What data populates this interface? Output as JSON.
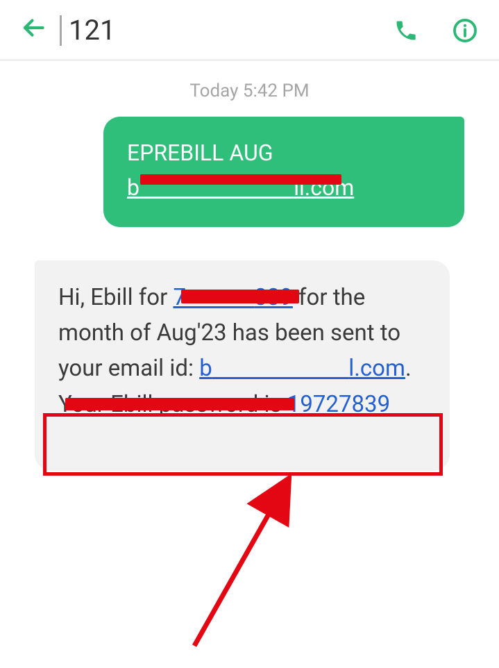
{
  "header": {
    "contact": "121"
  },
  "thread": {
    "timestamp": "Today 5:42 PM"
  },
  "messages": {
    "outgoing": {
      "line1": "EPREBILL AUG",
      "line2_prefix": "b",
      "line2_suffix": "il.com"
    },
    "incoming": {
      "t1": "Hi, Ebill for ",
      "num_prefix": "7",
      "num_suffix": "839",
      "t2": " for the month of Aug'23 has been sent to your email id: ",
      "mail_prefix": "b",
      "mail_suffix": "l.com",
      "t3": ". Your Ebill password is ",
      "password": "19727839"
    }
  }
}
